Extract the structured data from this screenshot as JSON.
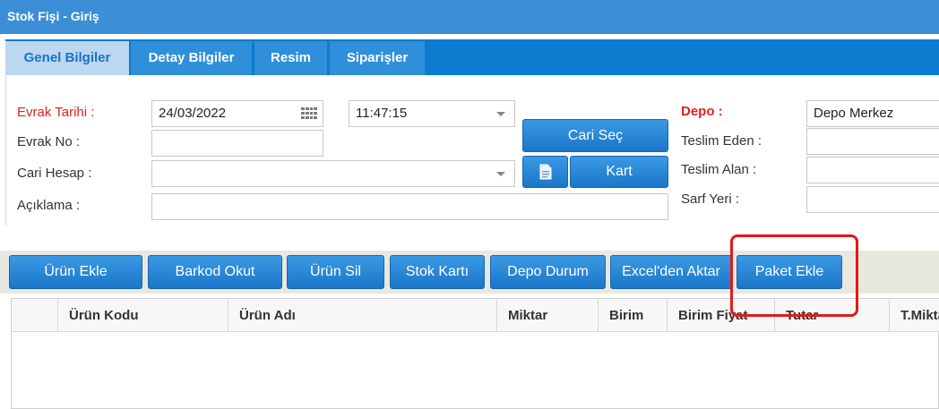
{
  "window": {
    "title": "Stok Fişi - Giriş"
  },
  "tabs": [
    {
      "label": "Genel Bilgiler",
      "active": true
    },
    {
      "label": "Detay Bilgiler",
      "active": false
    },
    {
      "label": "Resim",
      "active": false
    },
    {
      "label": "Siparişler",
      "active": false
    }
  ],
  "form": {
    "evrak_tarihi_label": "Evrak Tarihi :",
    "evrak_tarihi_value": "24/03/2022",
    "time_value": "11:47:15",
    "evrak_no_label": "Evrak No :",
    "evrak_no_value": "",
    "cari_hesap_label": "Cari Hesap :",
    "cari_hesap_value": "",
    "aciklama_label": "Açıklama :",
    "aciklama_value": "",
    "cari_sec_label": "Cari Seç",
    "kart_label": "Kart",
    "depo_label": "Depo :",
    "depo_value": "Depo Merkez",
    "teslim_eden_label": "Teslim Eden :",
    "teslim_alan_label": "Teslim Alan :",
    "sarf_yeri_label": "Sarf Yeri :"
  },
  "toolbar": {
    "urun_ekle": "Ürün Ekle",
    "barkod_okut": "Barkod Okut",
    "urun_sil": "Ürün Sil",
    "stok_karti": "Stok Kartı",
    "depo_durum": "Depo Durum",
    "excel_aktar": "Excel'den Aktar",
    "paket_ekle": "Paket Ekle"
  },
  "grid": {
    "columns": [
      "",
      "Ürün Kodu",
      "Ürün Adı",
      "Miktar",
      "Birim",
      "Birim Fiyat",
      "Tutar",
      "T.Miktar"
    ]
  },
  "colors": {
    "titlebar": "#3c8fd6",
    "tabbar": "#0c7bd0",
    "accent_red": "#e02020",
    "highlight": "#e11a1a"
  }
}
